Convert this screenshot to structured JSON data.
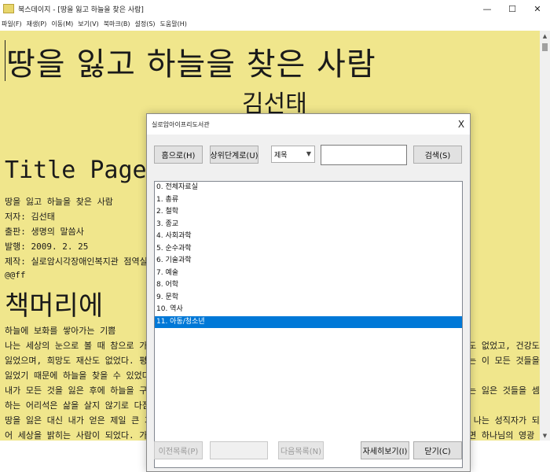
{
  "window": {
    "title": "북스데이지 - [땅을 잃고 하늘을 찾은 사람]",
    "minimize": "—",
    "maximize": "☐",
    "close": "✕"
  },
  "menu": [
    {
      "label": "파일(F)"
    },
    {
      "label": "재생(P)"
    },
    {
      "label": "이동(M)"
    },
    {
      "label": "보기(V)"
    },
    {
      "label": "북마크(B)"
    },
    {
      "label": "설정(S)"
    },
    {
      "label": "도움말(H)"
    }
  ],
  "document": {
    "title": "땅을 잃고 하늘을 찾은 사람",
    "author_big": "김선태",
    "title_page_heading": "Title Page",
    "meta_lines": [
      "땅을 잃고 하늘을 찾은 사람",
      "저자: 김선태",
      "출판: 생명의 말씀사",
      "발행: 2009. 2. 25",
      "제작: 실로암시각장애인복지관 점역실",
      "@@ff"
    ],
    "heading2": "책머리에",
    "body_lines": [
      "하늘에 보화를 쌓아가는 기쁨",
      "나는 세상의 눈으로 볼 때 참으로 가난했",
      "잃었으며, 희망도 재산도 없었다. 평범했",
      "잃었기 때문에 하늘을 찾을 수 있었다.",
      "내가 모든 것을 잃은 후에 하늘을 구하는",
      "하는 어리석은 삶을 살지 않기로 다짐했",
      "땅을 잃은 대신 내가 얻은 제일 큰 기쁨",
      "어 세상을 밝히는 사람이 되었다. 가진"
    ],
    "right_fragments": [
      "력도 없었고, 건강도",
      "나는 이 모든 것들을",
      "하는 잃은 것들을 셈",
      "은 나는 성직자가 되",
      "다면 하나님의 영광"
    ]
  },
  "dialog": {
    "title": "실로암아이프리도서관",
    "close": "X",
    "buttons": {
      "home": "홈으로(H)",
      "up": "상위단계로(U)",
      "search": "검색(S)",
      "prev": "이전목록(P)",
      "next": "다음목록(N)",
      "details": "자세히보기(I)",
      "close": "닫기(C)"
    },
    "search_field": {
      "selected": "제목",
      "query": "",
      "page": ""
    },
    "list_items": [
      "0. 전체자료실",
      "1. 총류",
      "2. 철학",
      "3. 종교",
      "4. 사회과학",
      "5. 순수과학",
      "6. 기술과학",
      "7. 예술",
      "8. 어학",
      "9. 문학",
      "10. 역사",
      "11. 아동/청소년"
    ],
    "selected_index": 11
  }
}
